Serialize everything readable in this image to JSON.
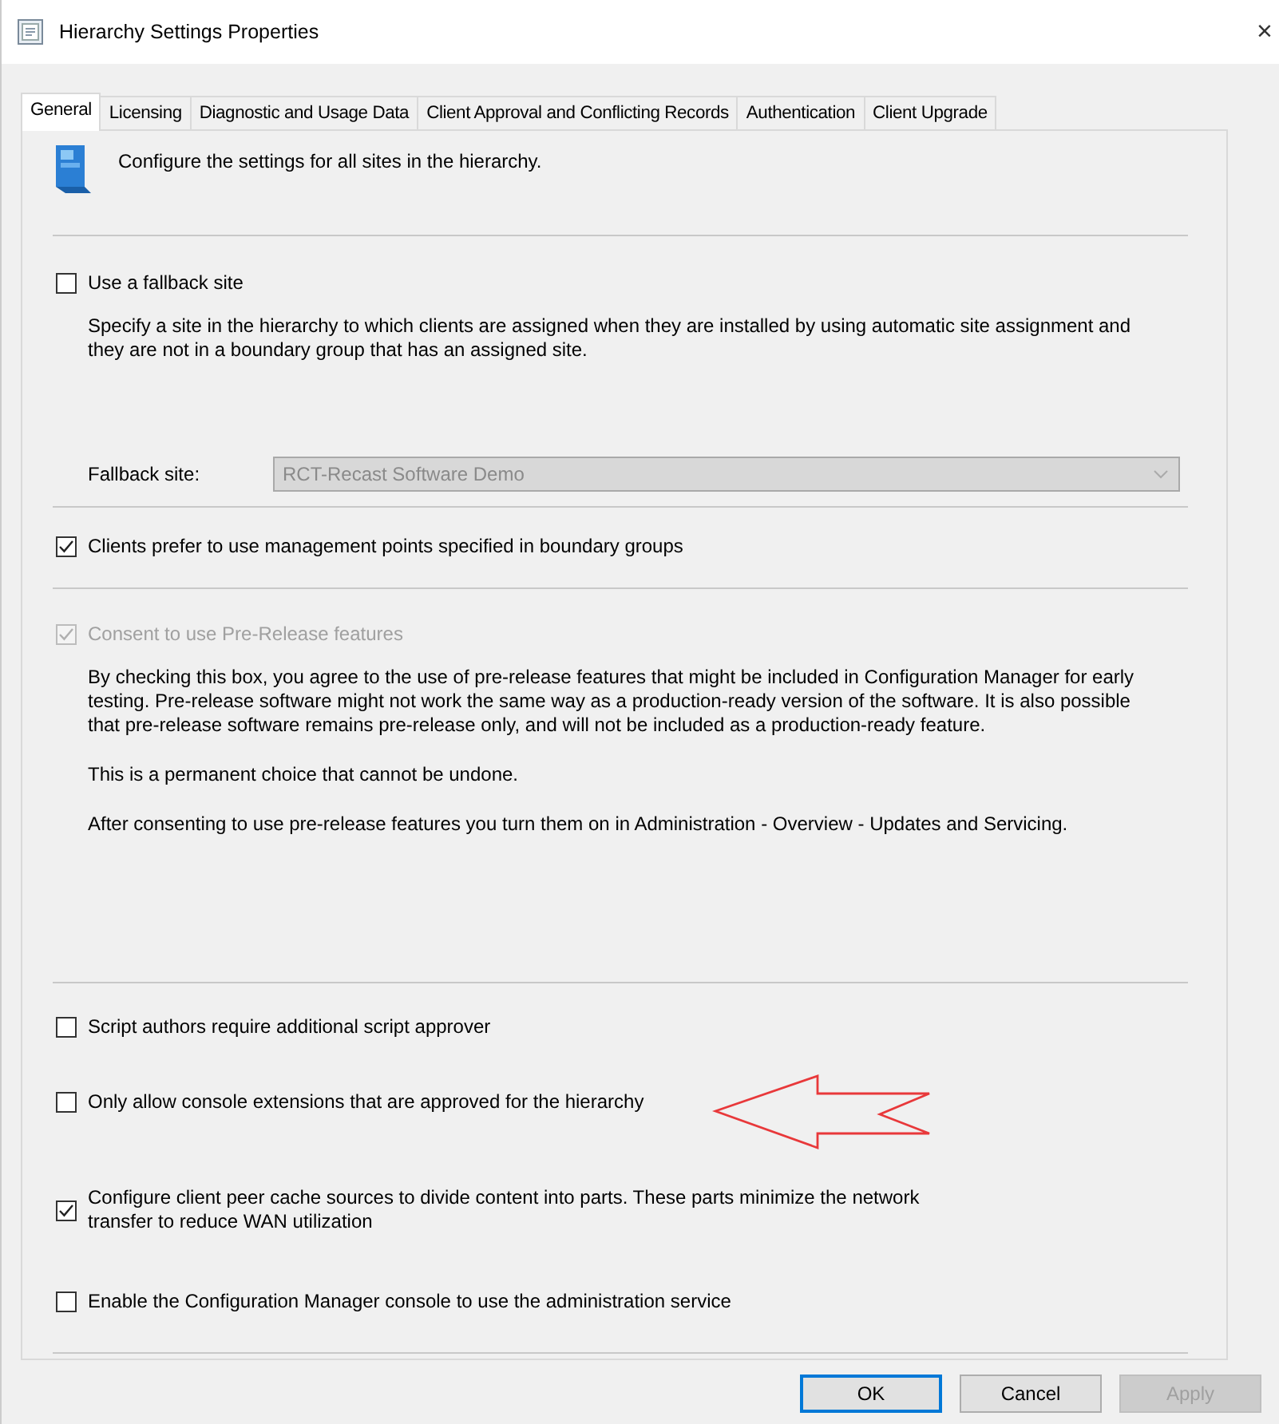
{
  "window": {
    "title": "Hierarchy Settings Properties",
    "close": "×"
  },
  "tabs": [
    {
      "label": "General",
      "selected": true
    },
    {
      "label": "Licensing",
      "selected": false
    },
    {
      "label": "Diagnostic and Usage Data",
      "selected": false
    },
    {
      "label": "Client Approval and Conflicting Records",
      "selected": false
    },
    {
      "label": "Authentication",
      "selected": false
    },
    {
      "label": "Client Upgrade",
      "selected": false
    }
  ],
  "header": "Configure the settings for all sites in the hierarchy.",
  "sections": [
    {
      "items": [
        {
          "kind": "checkbox",
          "label": "Use a fallback site",
          "checked": false,
          "disabled": false
        },
        {
          "kind": "text",
          "text": "Specify a site in the hierarchy to which clients are assigned when they are installed by using automatic site assignment and they are not in a boundary group that has an assigned site."
        },
        {
          "kind": "dropdown",
          "label": "Fallback site:",
          "value": "RCT-Recast Software Demo",
          "disabled": true
        }
      ]
    },
    {
      "items": [
        {
          "kind": "checkbox",
          "label": "Clients prefer to use management points specified in boundary groups",
          "checked": true,
          "disabled": false
        }
      ]
    },
    {
      "items": [
        {
          "kind": "checkbox",
          "label": "Consent to use Pre-Release features",
          "checked": true,
          "disabled": true
        },
        {
          "kind": "text",
          "text": "By checking this box, you agree to the use of pre-release features that might be included in Configuration Manager for early testing. Pre-release software might not work the same way as a production-ready version of the software. It is also possible that pre-release software remains pre-release only, and will not be included as a production-ready feature."
        },
        {
          "kind": "text",
          "text": "This is a permanent choice that cannot be undone."
        },
        {
          "kind": "text",
          "text": "After consenting to use pre-release features you turn them on in Administration - Overview - Updates and Servicing."
        }
      ]
    },
    {
      "items": [
        {
          "kind": "checkbox",
          "label": "Script authors require additional script approver",
          "checked": false,
          "disabled": false
        },
        {
          "kind": "checkbox",
          "label": "Only allow console extensions that are approved for the hierarchy",
          "checked": false,
          "disabled": false,
          "arrow": true
        },
        {
          "kind": "checkbox",
          "label": "Configure client peer cache sources to divide content into parts. These parts minimize the network transfer to reduce WAN utilization",
          "checked": true,
          "disabled": false
        },
        {
          "kind": "checkbox",
          "label": "Enable the Configuration Manager console to use the administration service",
          "checked": false,
          "disabled": false
        }
      ]
    }
  ],
  "buttons": [
    {
      "label": "OK",
      "default": true,
      "disabled": false
    },
    {
      "label": "Cancel",
      "default": false,
      "disabled": false
    },
    {
      "label": "Apply",
      "default": false,
      "disabled": true
    }
  ]
}
